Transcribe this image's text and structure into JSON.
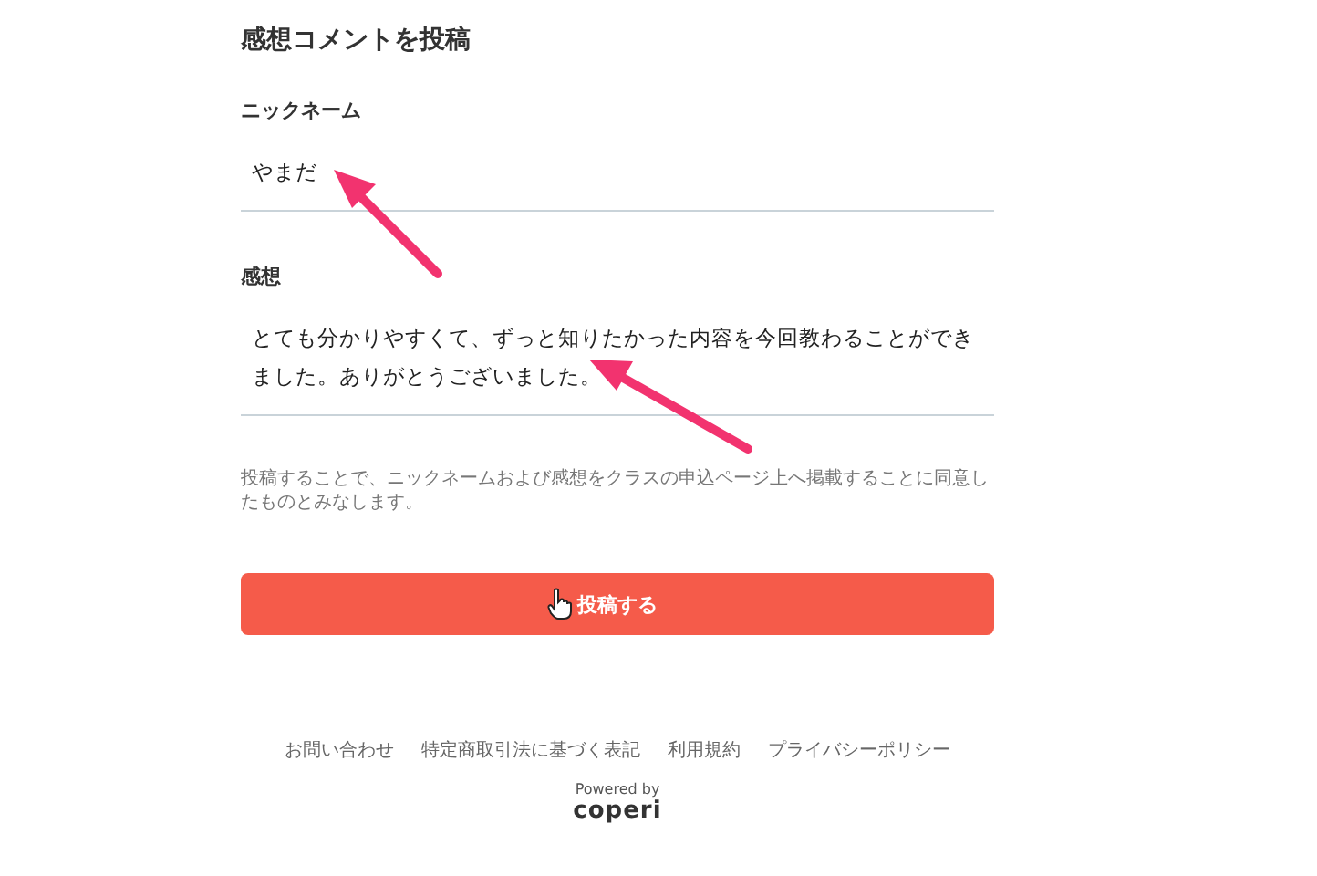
{
  "heading": "感想コメントを投稿",
  "fields": [
    {
      "label": "ニックネーム",
      "value": "やまだ",
      "kind": "input"
    },
    {
      "label": "感想",
      "value": "とても分かりやすくて、ずっと知りたかった内容を今回教わることができました。ありがとうございました。",
      "kind": "textarea"
    }
  ],
  "notice": "投稿することで、ニックネームおよび感想をクラスの申込ページ上へ掲載することに同意したものとみなします。",
  "submit_button": "投稿する",
  "footer_links": [
    "お問い合わせ",
    "特定商取引法に基づく表記",
    "利用規約",
    "プライバシーポリシー"
  ],
  "powered_by": "Powered by",
  "brand": "coperi"
}
